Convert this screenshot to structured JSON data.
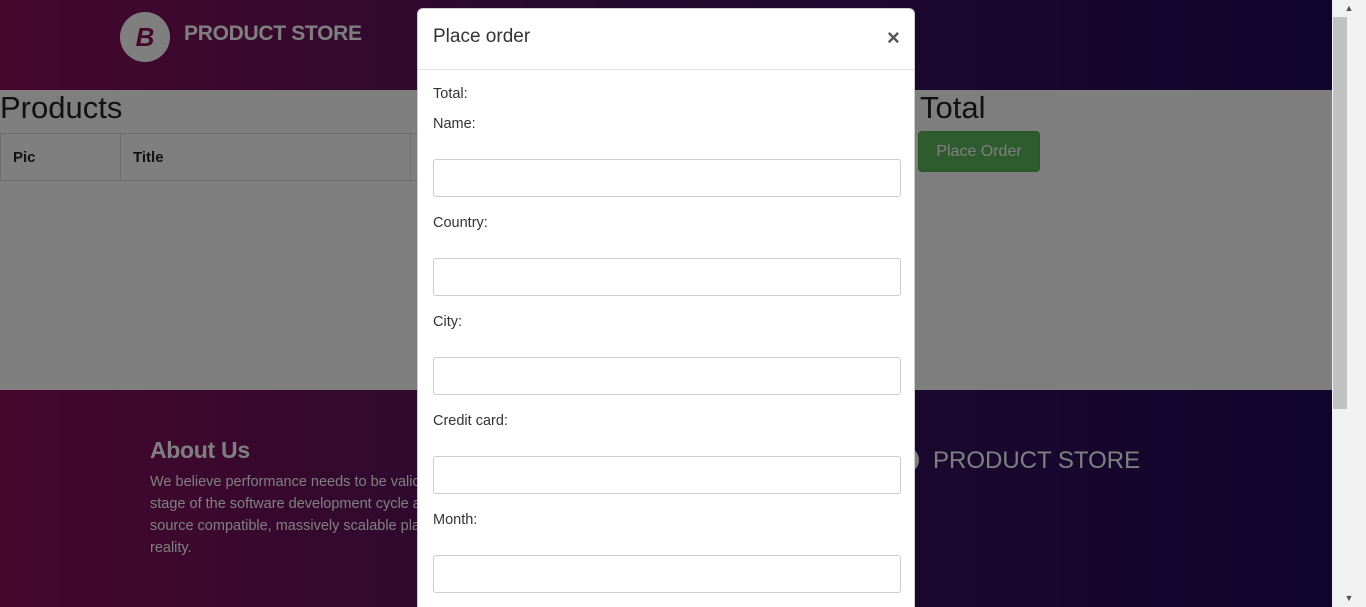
{
  "navbar": {
    "logo_letter": "B",
    "brand": "PRODUCT STORE"
  },
  "products": {
    "title": "Products",
    "columns": [
      "Pic",
      "Title"
    ]
  },
  "cart": {
    "total_title": "Total",
    "place_order_label": "Place Order"
  },
  "footer": {
    "about_title": "About Us",
    "about_text": "We believe performance needs to be valid stage of the software development cycle a source compatible, massively scalable plat a reality.",
    "brand": "PRODUCT STORE"
  },
  "modal": {
    "title": "Place order",
    "close_symbol": "×",
    "total_label": "Total:",
    "fields": [
      {
        "label": "Name:",
        "value": ""
      },
      {
        "label": "Country:",
        "value": ""
      },
      {
        "label": "City:",
        "value": ""
      },
      {
        "label": "Credit card:",
        "value": ""
      },
      {
        "label": "Month:",
        "value": ""
      }
    ]
  },
  "scrollbar": {
    "up_symbol": "▲",
    "down_symbol": "▼"
  }
}
